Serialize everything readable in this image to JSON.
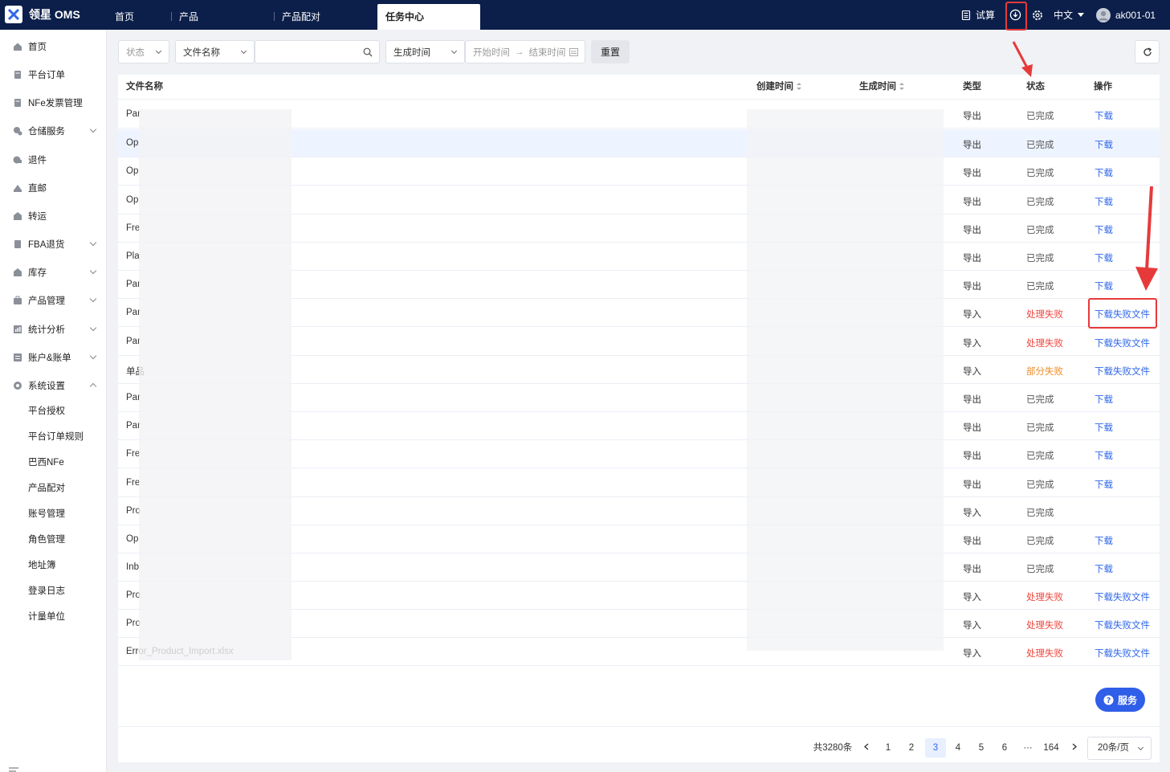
{
  "header": {
    "brand": "领星 OMS",
    "tabs": [
      {
        "label": "首页"
      },
      {
        "label": "产品"
      },
      {
        "label": "产品配对"
      },
      {
        "label": "任务中心",
        "active": true
      }
    ],
    "trial_label": "试算",
    "language_label": "中文",
    "username": "ak001-01",
    "colors": {
      "bar": "#0c1f4a",
      "accent": "#2f67e8"
    }
  },
  "sidebar": {
    "items": [
      {
        "label": "首页",
        "icon": "home-icon"
      },
      {
        "label": "平台订单",
        "icon": "order-icon"
      },
      {
        "label": "NFe发票管理",
        "icon": "invoice-icon"
      },
      {
        "label": "仓储服务",
        "icon": "warehouse-icon",
        "expandable": true
      },
      {
        "label": "退件",
        "icon": "return-icon"
      },
      {
        "label": "直邮",
        "icon": "mail-icon"
      },
      {
        "label": "转运",
        "icon": "transfer-icon"
      },
      {
        "label": "FBA退货",
        "icon": "fba-icon",
        "expandable": true
      },
      {
        "label": "库存",
        "icon": "inventory-icon",
        "expandable": true
      },
      {
        "label": "产品管理",
        "icon": "product-icon",
        "expandable": true
      },
      {
        "label": "统计分析",
        "icon": "stats-icon",
        "expandable": true
      },
      {
        "label": "账户&账单",
        "icon": "account-icon",
        "expandable": true
      },
      {
        "label": "系统设置",
        "icon": "settings-icon",
        "expandable": true,
        "expanded": true
      }
    ],
    "sub_items": [
      {
        "label": "平台授权"
      },
      {
        "label": "平台订单规则"
      },
      {
        "label": "巴西NFe"
      },
      {
        "label": "产品配对"
      },
      {
        "label": "账号管理"
      },
      {
        "label": "角色管理"
      },
      {
        "label": "地址簿"
      },
      {
        "label": "登录日志"
      },
      {
        "label": "计量单位"
      }
    ]
  },
  "filters": {
    "status_placeholder": "状态",
    "field_select": "文件名称",
    "search_value": "",
    "time_select": "生成时间",
    "start_placeholder": "开始时间",
    "end_placeholder": "结束时间",
    "range_arrow": "→",
    "reset_label": "重置"
  },
  "table": {
    "headers": {
      "filename": "文件名称",
      "created": "创建时间",
      "generated": "生成时间",
      "type": "类型",
      "status": "状态",
      "action": "操作"
    },
    "rows": [
      {
        "name": "Par",
        "type": "导出",
        "status": "已完成",
        "status_kind": "ok",
        "action": "下载"
      },
      {
        "name": "Op",
        "type": "导出",
        "status": "已完成",
        "status_kind": "ok",
        "action": "下载"
      },
      {
        "name": "Op",
        "type": "导出",
        "status": "已完成",
        "status_kind": "ok",
        "action": "下载"
      },
      {
        "name": "Op",
        "type": "导出",
        "status": "已完成",
        "status_kind": "ok",
        "action": "下载"
      },
      {
        "name": "Fre",
        "type": "导出",
        "status": "已完成",
        "status_kind": "ok",
        "action": "下载"
      },
      {
        "name": "Pla",
        "type": "导出",
        "status": "已完成",
        "status_kind": "ok",
        "action": "下载"
      },
      {
        "name": "Par",
        "type": "导出",
        "status": "已完成",
        "status_kind": "ok",
        "action": "下载"
      },
      {
        "name": "Par",
        "type": "导入",
        "status": "处理失败",
        "status_kind": "fail",
        "action": "下载失败文件"
      },
      {
        "name": "Par",
        "type": "导入",
        "status": "处理失败",
        "status_kind": "fail",
        "action": "下载失败文件"
      },
      {
        "name": "单品",
        "type": "导入",
        "status": "部分失败",
        "status_kind": "part",
        "action": "下载失败文件"
      },
      {
        "name": "Par",
        "type": "导出",
        "status": "已完成",
        "status_kind": "ok",
        "action": "下载"
      },
      {
        "name": "Par",
        "type": "导出",
        "status": "已完成",
        "status_kind": "ok",
        "action": "下载"
      },
      {
        "name": "Fre",
        "type": "导出",
        "status": "已完成",
        "status_kind": "ok",
        "action": "下载"
      },
      {
        "name": "Fre",
        "type": "导出",
        "status": "已完成",
        "status_kind": "ok",
        "action": "下载"
      },
      {
        "name": "Pro",
        "type": "导入",
        "status": "已完成",
        "status_kind": "ok",
        "action": ""
      },
      {
        "name": "Op",
        "type": "导出",
        "status": "已完成",
        "status_kind": "ok",
        "action": "下载"
      },
      {
        "name": "Inb",
        "type": "导出",
        "status": "已完成",
        "status_kind": "ok",
        "action": "下载"
      },
      {
        "name": "Pro",
        "type": "导入",
        "status": "处理失败",
        "status_kind": "fail",
        "action": "下载失败文件"
      },
      {
        "name": "Pro",
        "type": "导入",
        "status": "处理失败",
        "status_kind": "fail",
        "action": "下载失败文件"
      },
      {
        "name": "Error_Product_Import.xlsx",
        "type": "导入",
        "status": "处理失败",
        "status_kind": "fail",
        "action": "下载失败文件"
      }
    ]
  },
  "pagination": {
    "total": "共3280条",
    "pages": [
      "1",
      "2",
      "3",
      "4",
      "5",
      "6"
    ],
    "current": "3",
    "ellipsis": "···",
    "last": "164",
    "page_size": "20条/页"
  },
  "service_label": "服务"
}
